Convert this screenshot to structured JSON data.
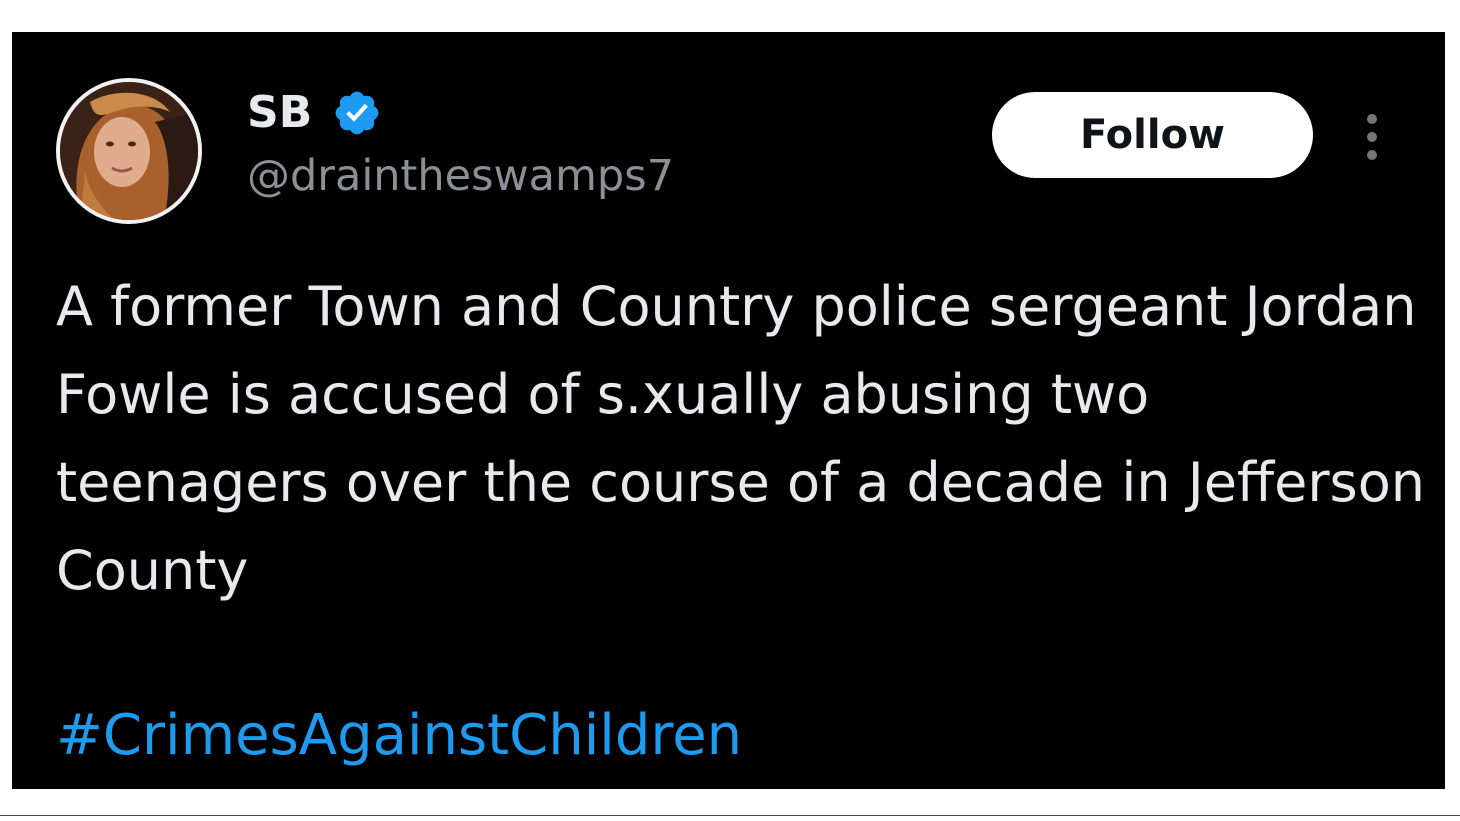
{
  "tweet": {
    "author": {
      "display_name": "SB",
      "handle": "@draintheswamps7",
      "verified": true,
      "avatar_icon": "profile-photo"
    },
    "follow_label": "Follow",
    "more_icon": "vertical-ellipsis-icon",
    "text": "A former Town and Country police sergeant Jordan Fowle is accused of s.xually abusing two teenagers over the course of a decade in Jefferson County",
    "hashtag": "#CrimesAgainstChildren"
  },
  "colors": {
    "background": "#000000",
    "text": "#e7e9ea",
    "secondary_text": "#8b9096",
    "accent": "#1d9bf0",
    "follow_button_bg": "#ffffff"
  }
}
